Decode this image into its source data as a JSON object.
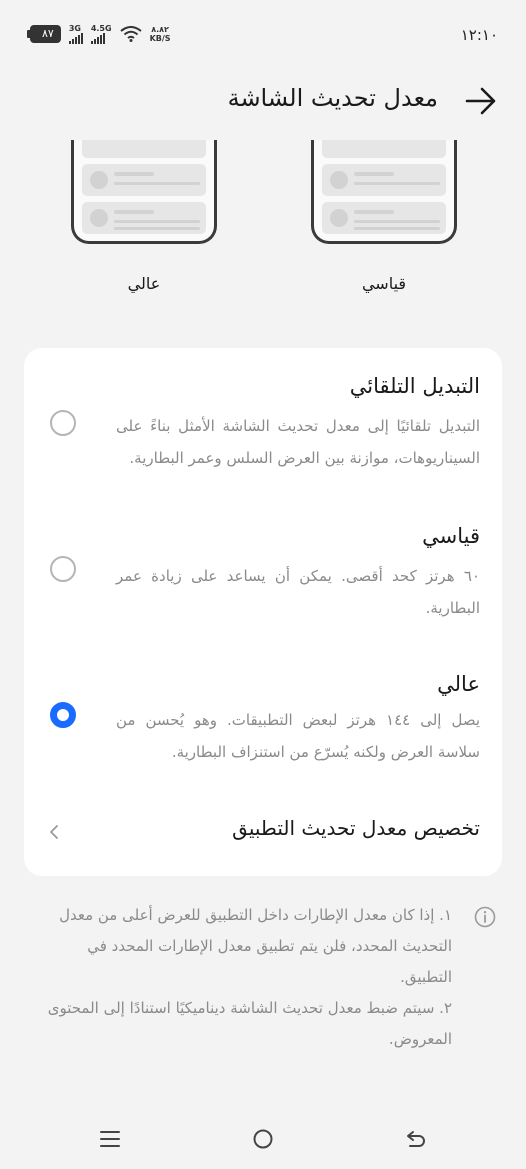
{
  "status_bar": {
    "time": "١٢:١٠",
    "battery": "٨٧",
    "network_1": "3G",
    "network_2": "4.5G",
    "speed_value": "٨.٨٢",
    "speed_unit": "KB/S"
  },
  "header": {
    "title": "معدل تحديث الشاشة"
  },
  "preview": {
    "standard_label": "قياسي",
    "high_label": "عالي"
  },
  "options": {
    "auto": {
      "title": "التبديل التلقائي",
      "description": "التبديل تلقائيًا إلى معدل تحديث الشاشة الأمثل بناءً على السيناريوهات، موازنة بين العرض السلس وعمر البطارية.",
      "selected": false
    },
    "standard": {
      "title": "قياسي",
      "description": "٦٠ هرتز كحد أقصى. يمكن أن يساعد على زيادة عمر البطارية.",
      "selected": false
    },
    "high": {
      "title": "عالي",
      "description": "يصل إلى ١٤٤ هرتز لبعض التطبيقات. وهو يُحسن من سلاسة العرض ولكنه يُسرّع من استنزاف البطارية.",
      "selected": true
    }
  },
  "app_rate": {
    "label": "تخصيص معدل تحديث التطبيق"
  },
  "info": {
    "note_1": "١. إذا كان معدل الإطارات داخل التطبيق للعرض أعلى من معدل التحديث المحدد، فلن يتم تطبيق معدل الإطارات المحدد في التطبيق.",
    "note_2": "٢. سيتم ضبط معدل تحديث الشاشة ديناميكيًا استنادًا إلى المحتوى المعروض."
  },
  "colors": {
    "accent": "#1a6bff",
    "background": "#f3f3f3",
    "card": "#ffffff",
    "secondary_text": "#8a8a8a"
  },
  "icons": {
    "back": "arrow-right-icon",
    "chevron": "chevron-left-icon",
    "info": "info-icon",
    "nav_menu": "menu-icon",
    "nav_home": "home-circle-icon",
    "nav_back": "back-arrow-icon"
  }
}
